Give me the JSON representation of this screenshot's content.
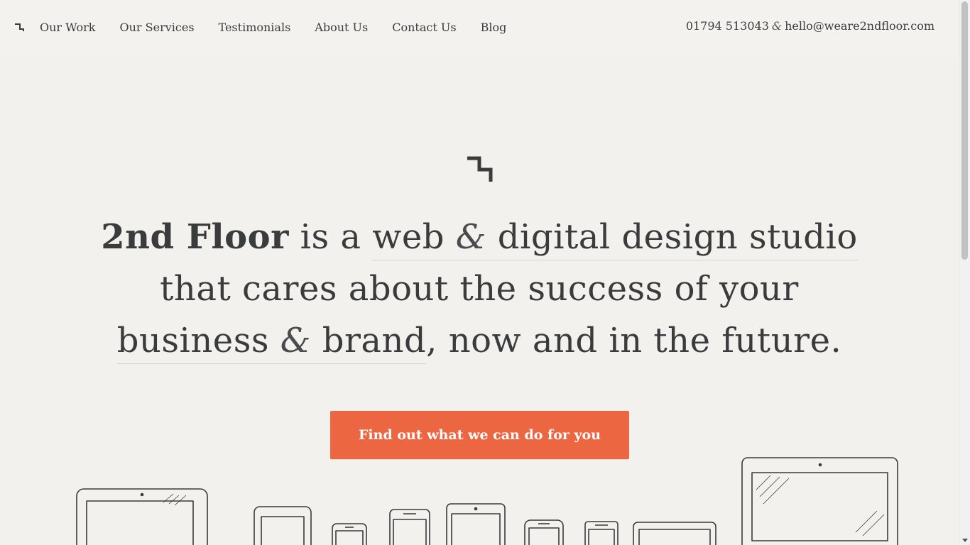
{
  "nav": {
    "logo_icon": "step-logo-icon",
    "items": [
      {
        "label": "Our Work"
      },
      {
        "label": "Our Services"
      },
      {
        "label": "Testimonials"
      },
      {
        "label": "About Us"
      },
      {
        "label": "Contact Us"
      },
      {
        "label": "Blog"
      }
    ],
    "phone": "01794 513043",
    "amp": "&",
    "email": "hello@weare2ndfloor.com"
  },
  "hero": {
    "mark_icon": "step-logo-icon",
    "brand": "2nd Floor",
    "is_a": " is a ",
    "web": "web",
    "amp1": "&",
    "digital": "digital design studio",
    "line2": "that cares about the success of your",
    "business": "business",
    "amp2": "&",
    "brand_word": "brand",
    "tail": ", now and in the future.",
    "cta_label": "Find out what we can do for you"
  },
  "colors": {
    "background": "#f3f1ed",
    "text": "#3a3b3d",
    "accent": "#ec6642"
  }
}
